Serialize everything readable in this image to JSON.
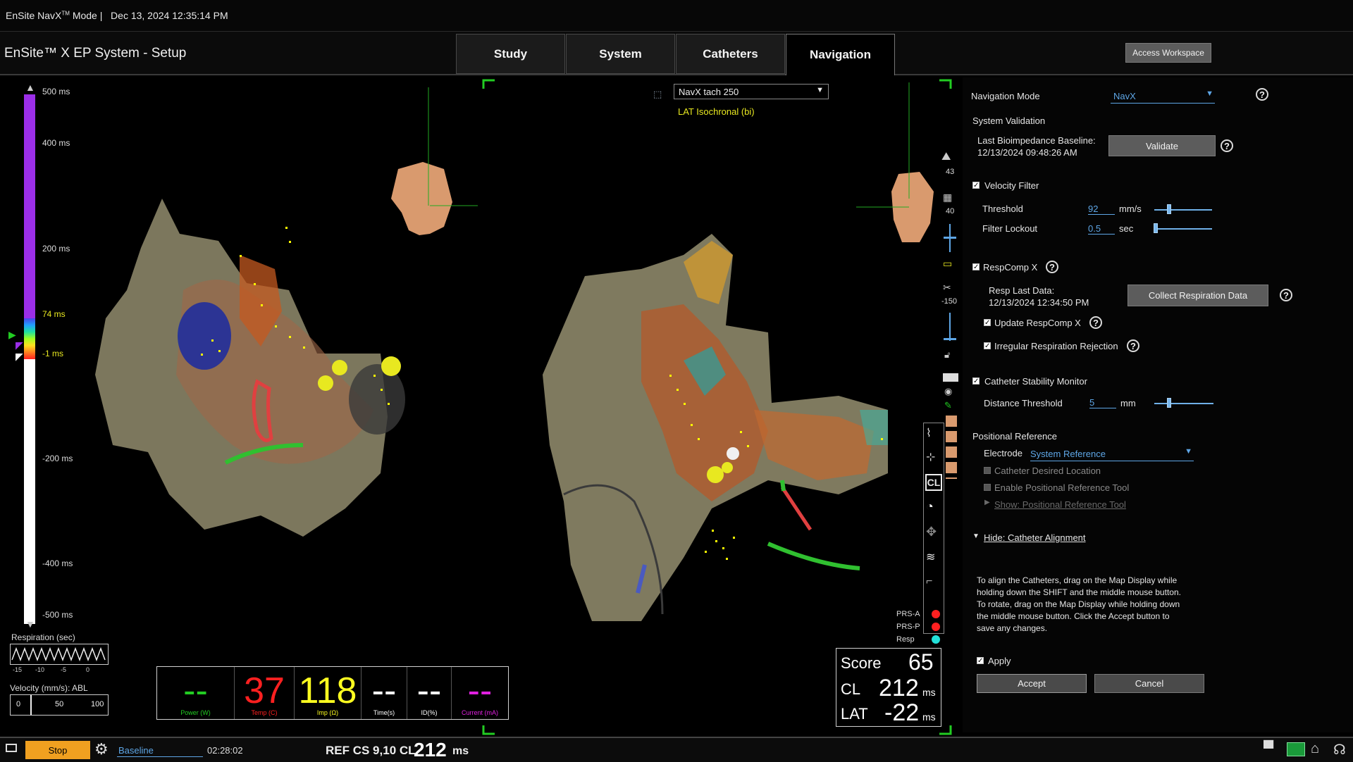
{
  "top": {
    "mode_prefix": "EnSite NavX",
    "mode_tm": "TM",
    "mode_suffix": " Mode |",
    "datetime": "Dec 13, 2024 12:35:14 PM"
  },
  "app": {
    "title": "EnSite™ X EP System - Setup",
    "tabs": [
      "Study",
      "System",
      "Catheters",
      "Navigation"
    ],
    "active_tab": "Navigation",
    "access_workspace": "Access Workspace"
  },
  "map": {
    "dropdown_value": "NavX tach 250",
    "map_label": "LAT Isochronal (bi)",
    "scale_labels": [
      "500 ms",
      "400 ms",
      "200 ms",
      "74 ms",
      "-1 ms",
      "-200 ms",
      "-400 ms",
      "-500 ms"
    ],
    "side_numbers": [
      "43",
      "40",
      "-150"
    ],
    "respiration_label": "Respiration (sec)",
    "respiration_ticks": [
      "-15",
      "-10",
      "-5",
      "0"
    ],
    "velocity_label": "Velocity (mm/s): ABL",
    "velocity_ticks": [
      "0",
      "50",
      "100"
    ],
    "legend": [
      {
        "label": "PRS-A",
        "color": "#ff2020"
      },
      {
        "label": "PRS-P",
        "color": "#ff2020"
      },
      {
        "label": "Resp",
        "color": "#22e0d8"
      }
    ],
    "cl_icon": "CL"
  },
  "metrics": [
    {
      "value": "--",
      "label": "Power (W)",
      "color": "#22cc22"
    },
    {
      "value": "37",
      "label": "Temp (C)",
      "color": "#ff2020"
    },
    {
      "value": "118",
      "label": "Imp (Ω)",
      "color": "#ffff20"
    },
    {
      "value": "--",
      "label": "Time(s)",
      "color": "#ffffff"
    },
    {
      "value": "--",
      "label": "ID(%)",
      "color": "#ffffff"
    },
    {
      "value": "--",
      "label": "Current (mA)",
      "color": "#e020e0"
    }
  ],
  "score": {
    "score_label": "Score",
    "score_value": "65",
    "cl_label": "CL",
    "cl_value": "212",
    "cl_unit": "ms",
    "lat_label": "LAT",
    "lat_value": "-22",
    "lat_unit": "ms"
  },
  "panel": {
    "nav_mode_label": "Navigation Mode",
    "nav_mode_value": "NavX",
    "system_validation": "System Validation",
    "last_bio_label": "Last Bioimpedance Baseline:",
    "last_bio_value": "12/13/2024 09:48:26 AM",
    "validate": "Validate",
    "velocity_filter": "Velocity Filter",
    "threshold_label": "Threshold",
    "threshold_value": "92",
    "threshold_unit": "mm/s",
    "threshold_level": 0.25,
    "filter_lockout_label": "Filter Lockout",
    "filter_lockout_value": "0.5",
    "filter_lockout_unit": "sec",
    "filter_lockout_level": 0.02,
    "respcomp": "RespComp X",
    "resp_last_label": "Resp Last Data:",
    "resp_last_value": "12/13/2024 12:34:50 PM",
    "collect_resp": "Collect Respiration Data",
    "update_respcomp": "Update RespComp X",
    "irregular_resp": "Irregular Respiration Rejection",
    "cath_stability": "Catheter Stability Monitor",
    "distance_label": "Distance Threshold",
    "distance_value": "5",
    "distance_unit": "mm",
    "distance_level": 0.25,
    "positional_ref": "Positional Reference",
    "electrode_label": "Electrode",
    "electrode_value": "System Reference",
    "cath_desired": "Catheter Desired Location",
    "enable_prt": "Enable Positional Reference Tool",
    "show_prt": "Show: Positional Reference Tool",
    "hide_align": "Hide: Catheter Alignment",
    "align_text_1": "To align the Catheters, drag on the Map Display while",
    "align_text_2": "holding down the SHIFT and the middle mouse button.",
    "align_text_3": "To rotate, drag on the Map Display while holding down",
    "align_text_4": "the middle mouse button.  Click the Accept button to",
    "align_text_5": "save any changes.",
    "apply": "Apply",
    "accept": "Accept",
    "cancel": "Cancel"
  },
  "bottom": {
    "stop": "Stop",
    "baseline": "Baseline",
    "timer": "02:28:02",
    "ref_prefix": "REF CS 9,10 CL",
    "ref_value": "212",
    "ref_unit": "ms"
  }
}
